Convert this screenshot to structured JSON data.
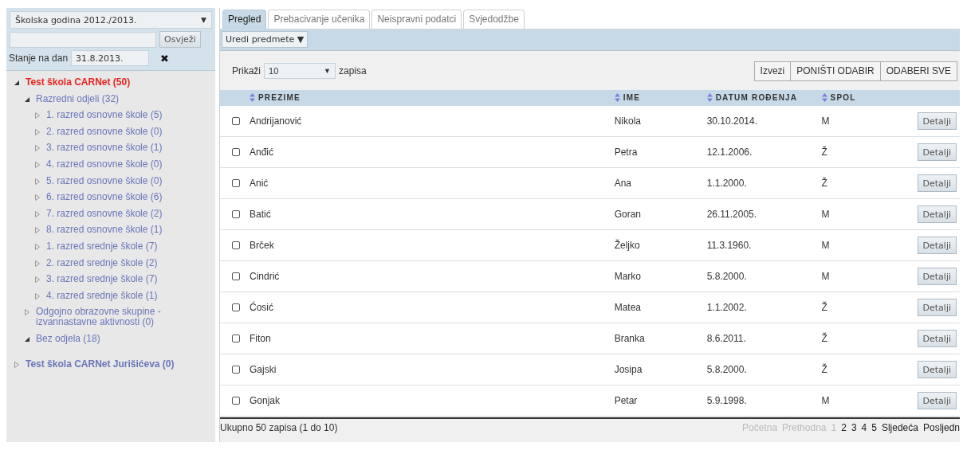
{
  "sidebar": {
    "year_select": {
      "value": "Školska godina 2012./2013.",
      "arrow": "▼"
    },
    "refresh_button": "Osvježi",
    "date_label": "Stanje na dan",
    "date_field": {
      "value": "31.8.2013."
    },
    "clear_date": "✖",
    "tree": [
      {
        "label": "Test škola CARNet (50)",
        "expanded": true,
        "selected": true,
        "children": [
          {
            "label": "Razredni odjeli (32)",
            "expanded": true,
            "selected": false,
            "children": [
              {
                "label": "1. razred osnovne škole (5)",
                "expanded": false,
                "selected": false
              },
              {
                "label": "2. razred osnovne škole (0)",
                "expanded": false,
                "selected": false
              },
              {
                "label": "3. razred osnovne škole (1)",
                "expanded": false,
                "selected": false
              },
              {
                "label": "4. razred osnovne škole (0)",
                "expanded": false,
                "selected": false
              },
              {
                "label": "5. razred osnovne škole (0)",
                "expanded": false,
                "selected": false
              },
              {
                "label": "6. razred osnovne škole (6)",
                "expanded": false,
                "selected": false
              },
              {
                "label": "7. razred osnovne škole (2)",
                "expanded": false,
                "selected": false
              },
              {
                "label": "8. razred osnovne škole (1)",
                "expanded": false,
                "selected": false
              },
              {
                "label": "1. razred srednje škole (7)",
                "expanded": false,
                "selected": false
              },
              {
                "label": "2. razred srednje škole (2)",
                "expanded": false,
                "selected": false
              },
              {
                "label": "3. razred srednje škole (7)",
                "expanded": false,
                "selected": false
              },
              {
                "label": "4. razred srednje škole (1)",
                "expanded": false,
                "selected": false
              }
            ]
          },
          {
            "label": "Odgojno obrazovne skupine - izvannastavne aktivnosti (0)",
            "expanded": false,
            "selected": false
          },
          {
            "label": "Bez odjela (18)",
            "expanded": true,
            "selected": false
          }
        ]
      },
      {
        "label": "Test škola CARNet Jurišićeva (0)",
        "expanded": false,
        "selected": false
      }
    ]
  },
  "tabs": [
    {
      "label": "Pregled",
      "selected": true
    },
    {
      "label": "Prebacivanje učenika",
      "selected": false
    },
    {
      "label": "Neispravni podatci",
      "selected": false
    },
    {
      "label": "Svjedodžbe",
      "selected": false
    }
  ],
  "toolbar": {
    "menu_button": "Uredi predmete ▼"
  },
  "page_size": {
    "label": "Prikaži",
    "value": "10",
    "arrow": "▼",
    "suffix": "zapisa"
  },
  "actions": [
    "Izvezi",
    "PONIŠTI ODABIR",
    "ODABERI SVE"
  ],
  "table": {
    "columns": [
      "PREZIME",
      "IME",
      "DATUM ROĐENJA",
      "SPOL"
    ],
    "rows": [
      {
        "checked": false,
        "cells": [
          "Andrijanović",
          "Nikola",
          "30.10.2014.",
          "M"
        ],
        "button": "Detalji"
      },
      {
        "checked": false,
        "cells": [
          "Anđić",
          "Petra",
          "12.1.2006.",
          "Ž"
        ],
        "button": "Detalji"
      },
      {
        "checked": false,
        "cells": [
          "Anić",
          "Ana",
          "1.1.2000.",
          "Ž"
        ],
        "button": "Detalji"
      },
      {
        "checked": false,
        "cells": [
          "Batić",
          "Goran",
          "26.11.2005.",
          "M"
        ],
        "button": "Detalji"
      },
      {
        "checked": false,
        "cells": [
          "Brček",
          "Željko",
          "11.3.1960.",
          "M"
        ],
        "button": "Detalji"
      },
      {
        "checked": false,
        "cells": [
          "Cindrić",
          "Marko",
          "5.8.2000.",
          "M"
        ],
        "button": "Detalji"
      },
      {
        "checked": false,
        "cells": [
          "Ćosić",
          "Matea",
          "1.1.2002.",
          "Ž"
        ],
        "button": "Detalji"
      },
      {
        "checked": false,
        "cells": [
          "Fiton",
          "Branka",
          "8.6.2011.",
          "Ž"
        ],
        "button": "Detalji"
      },
      {
        "checked": false,
        "cells": [
          "Gajski",
          "Josipa",
          "5.8.2000.",
          "Ž"
        ],
        "button": "Detalji"
      },
      {
        "checked": false,
        "cells": [
          "Gonjak",
          "Petar",
          "5.9.1998.",
          "M"
        ],
        "button": "Detalji"
      }
    ]
  },
  "footer": {
    "summary": "Ukupno 50 zapisa (1 do 10)",
    "pages": [
      {
        "label": "Početna",
        "disabled": true
      },
      {
        "label": "Prethodna",
        "disabled": true
      },
      {
        "label": "1",
        "disabled": true
      },
      {
        "label": "2",
        "disabled": false
      },
      {
        "label": "3",
        "disabled": false
      },
      {
        "label": "4",
        "disabled": false
      },
      {
        "label": "5",
        "disabled": false
      },
      {
        "label": "Sljedeća",
        "disabled": false
      },
      {
        "label": "Posljedn",
        "disabled": false
      }
    ]
  }
}
